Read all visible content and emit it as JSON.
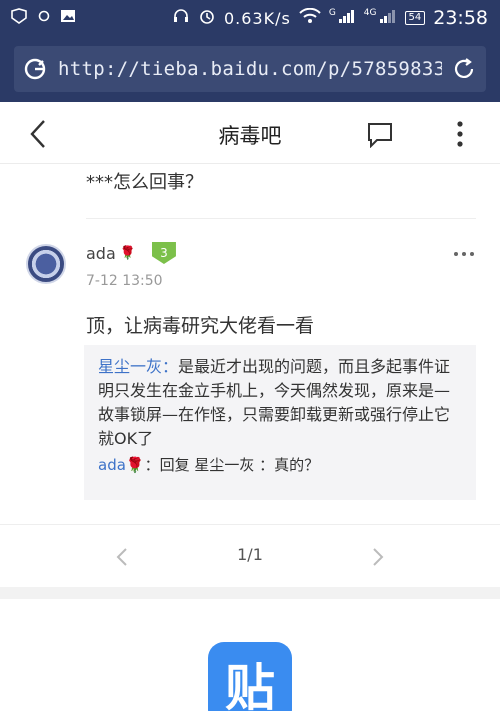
{
  "status_bar": {
    "net_speed": "0.63K/s",
    "signal_g": "G",
    "signal_4g": "4G",
    "battery": "54",
    "time": "23:58"
  },
  "browser": {
    "url": "http://tieba.baidu.com/p/57859833"
  },
  "header": {
    "title": "病毒吧"
  },
  "prev_post": {
    "text": "***怎么回事？"
  },
  "post": {
    "author": "ada",
    "author_badge": "🌹",
    "level": "3",
    "time": "7-12 13:50",
    "content": "顶，让病毒研究大佬看一看",
    "replies": [
      {
        "name": "星尘一灰",
        "separator": "：",
        "text": "是最近才出现的问题，而且多起事件证明只发生在金立手机上，今天偶然发现，原来是—故事锁屏—在作怪，只需要卸载更新或强行停止它就OK了"
      },
      {
        "name": "ada🌹",
        "separator": "：",
        "text": "回复 星尘一灰 ：真的？"
      }
    ]
  },
  "pager": {
    "page_label": "1/1"
  },
  "footer": {
    "logo_char": "贴"
  },
  "colors": {
    "status_bg": "#2b3a66",
    "link_blue": "#3d72c8",
    "level_green": "#7cc04a",
    "logo_blue": "#3a8cf0"
  },
  "icons": [
    "back-icon",
    "comment-icon",
    "more-icon",
    "browser-logo-icon",
    "reload-icon",
    "chevron-left-icon",
    "chevron-right-icon"
  ]
}
